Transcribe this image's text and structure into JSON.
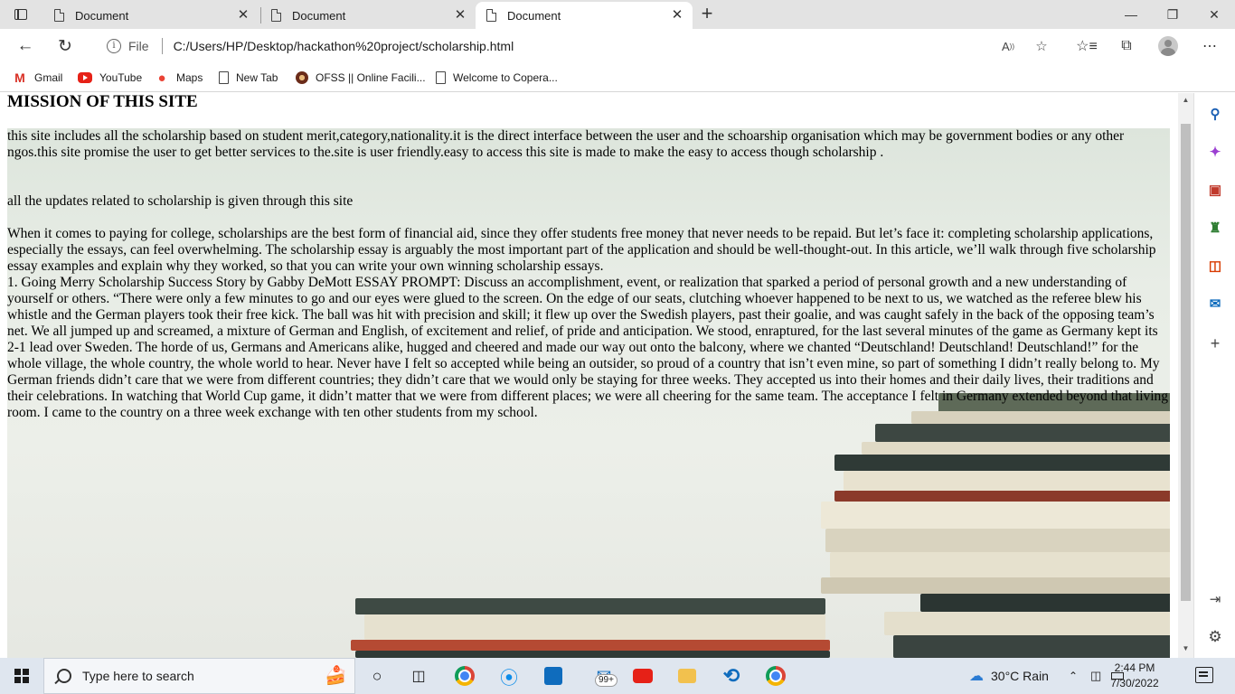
{
  "browser": {
    "tabs": [
      {
        "title": "Document",
        "active": false
      },
      {
        "title": "Document",
        "active": false
      },
      {
        "title": "Document",
        "active": true
      }
    ],
    "address": {
      "scheme_label": "File",
      "url": "C:/Users/HP/Desktop/hackathon%20project/scholarship.html"
    },
    "favorites": [
      {
        "label": "Gmail",
        "icon": "gmail-icon"
      },
      {
        "label": "YouTube",
        "icon": "youtube-icon"
      },
      {
        "label": "Maps",
        "icon": "maps-icon"
      },
      {
        "label": "New Tab",
        "icon": "page-icon"
      },
      {
        "label": "OFSS || Online Facili...",
        "icon": "ofss-icon"
      },
      {
        "label": "Welcome to Copera...",
        "icon": "page-icon"
      }
    ]
  },
  "page": {
    "heading": "MISSION OF THIS SITE",
    "intro": "this site includes all the scholarship based on student merit,category,nationality.it is the direct interface between the user and the schoarship organisation which may be government bodies or any other ngos.this site promise the user to get better services to the.site is user friendly.easy to access this site is made to make the easy to access though scholarship .",
    "updates": "all the updates related to scholarship is given through this site",
    "body_1": "When it comes to paying for college, scholarships are the best form of financial aid, since they offer students free money that never needs to be repaid. But let’s face it: completing scholarship applications, especially the essays, can feel overwhelming. The scholarship essay is arguably the most important part of the application and should be well-thought-out. In this article, we’ll walk through five scholarship essay examples and explain why they worked, so that you can write your own winning scholarship essays.",
    "body_2": "1. Going Merry Scholarship Success Story by Gabby DeMott ESSAY PROMPT: Discuss an accomplishment, event, or realization that sparked a period of personal growth and a new understanding of yourself or others. “There were only a few minutes to go and our eyes were glued to the screen. On the edge of our seats, clutching whoever happened to be next to us, we watched as the referee blew his whistle and the German players took their free kick. The ball was hit with precision and skill; it flew up over the Swedish players, past their goalie, and was caught safely in the back of the opposing team’s net. We all jumped up and screamed, a mixture of German and English, of excitement and relief, of pride and anticipation. We stood, enraptured, for the last several minutes of the game as Germany kept its 2-1 lead over Sweden. The horde of us, Germans and Americans alike, hugged and cheered and made our way out onto the balcony, where we chanted “Deutschland! Deutschland! Deutschland!” for the whole village, the whole country, the whole world to hear. Never have I felt so accepted while being an outsider, so proud of a country that isn’t even mine, so part of something I didn’t really belong to. My German friends didn’t care that we were from different countries; they didn’t care that we would only be staying for three weeks. They accepted us into their homes and their daily lives, their traditions and their celebrations. In watching that World Cup game, it didn’t matter that we were from different places; we were all cheering for the same team. The acceptance I felt in Germany extended beyond that living room. I came to the country on a three week exchange with ten other students from my school."
  },
  "taskbar": {
    "search_placeholder": "Type here to search",
    "mail_badge": "99+",
    "weather": "30°C  Rain",
    "time": "2:44 PM",
    "date": "7/30/2022"
  },
  "colors": {
    "tabstrip": "#e3e3e3",
    "taskbar": "#dfe6ef",
    "page_bg": "#e6ebe4"
  }
}
